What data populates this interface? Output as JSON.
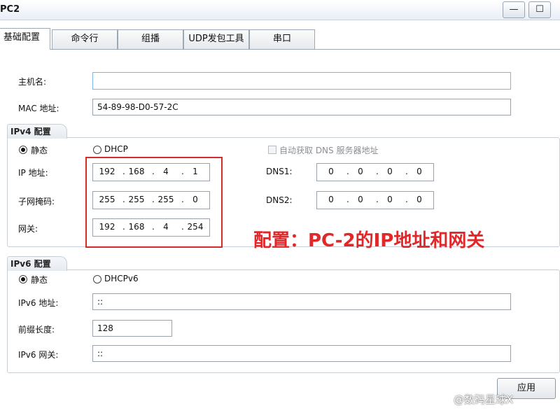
{
  "window": {
    "title": "PC2",
    "minimize_glyph": "—",
    "maximize_glyph": "☐"
  },
  "tabs": [
    {
      "label": "基础配置",
      "active": true
    },
    {
      "label": "命令行",
      "active": false
    },
    {
      "label": "组播",
      "active": false
    },
    {
      "label": "UDP发包工具",
      "active": false
    },
    {
      "label": "串口",
      "active": false
    }
  ],
  "basic": {
    "hostname_label": "主机名:",
    "hostname_value": "",
    "mac_label": "MAC 地址:",
    "mac_value": "54-89-98-D0-57-2C"
  },
  "ipv4": {
    "title": "IPv4 配置",
    "static_label": "静态",
    "static_checked": true,
    "dhcp_label": "DHCP",
    "dhcp_checked": false,
    "auto_dns_label": "自动获取 DNS 服务器地址",
    "auto_dns_checked": false,
    "ip_label": "IP 地址:",
    "ip": [
      "192",
      "168",
      "4",
      "1"
    ],
    "mask_label": "子网掩码:",
    "mask": [
      "255",
      "255",
      "255",
      "0"
    ],
    "gateway_label": "网关:",
    "gateway": [
      "192",
      "168",
      "4",
      "254"
    ],
    "dns1_label": "DNS1:",
    "dns1": [
      "0",
      "0",
      "0",
      "0"
    ],
    "dns2_label": "DNS2:",
    "dns2": [
      "0",
      "0",
      "0",
      "0"
    ]
  },
  "ipv6": {
    "title": "IPv6 配置",
    "static_label": "静态",
    "static_checked": true,
    "dhcpv6_label": "DHCPv6",
    "dhcpv6_checked": false,
    "address_label": "IPv6 地址:",
    "address_value": "::",
    "prefix_label": "前缀长度:",
    "prefix_value": "128",
    "gateway_label": "IPv6 网关:",
    "gateway_value": "::"
  },
  "annotation": {
    "text": "配置：PC-2的IP地址和网关",
    "color": "#e0282a"
  },
  "apply_label": "应用",
  "watermark": "@数码星球X"
}
